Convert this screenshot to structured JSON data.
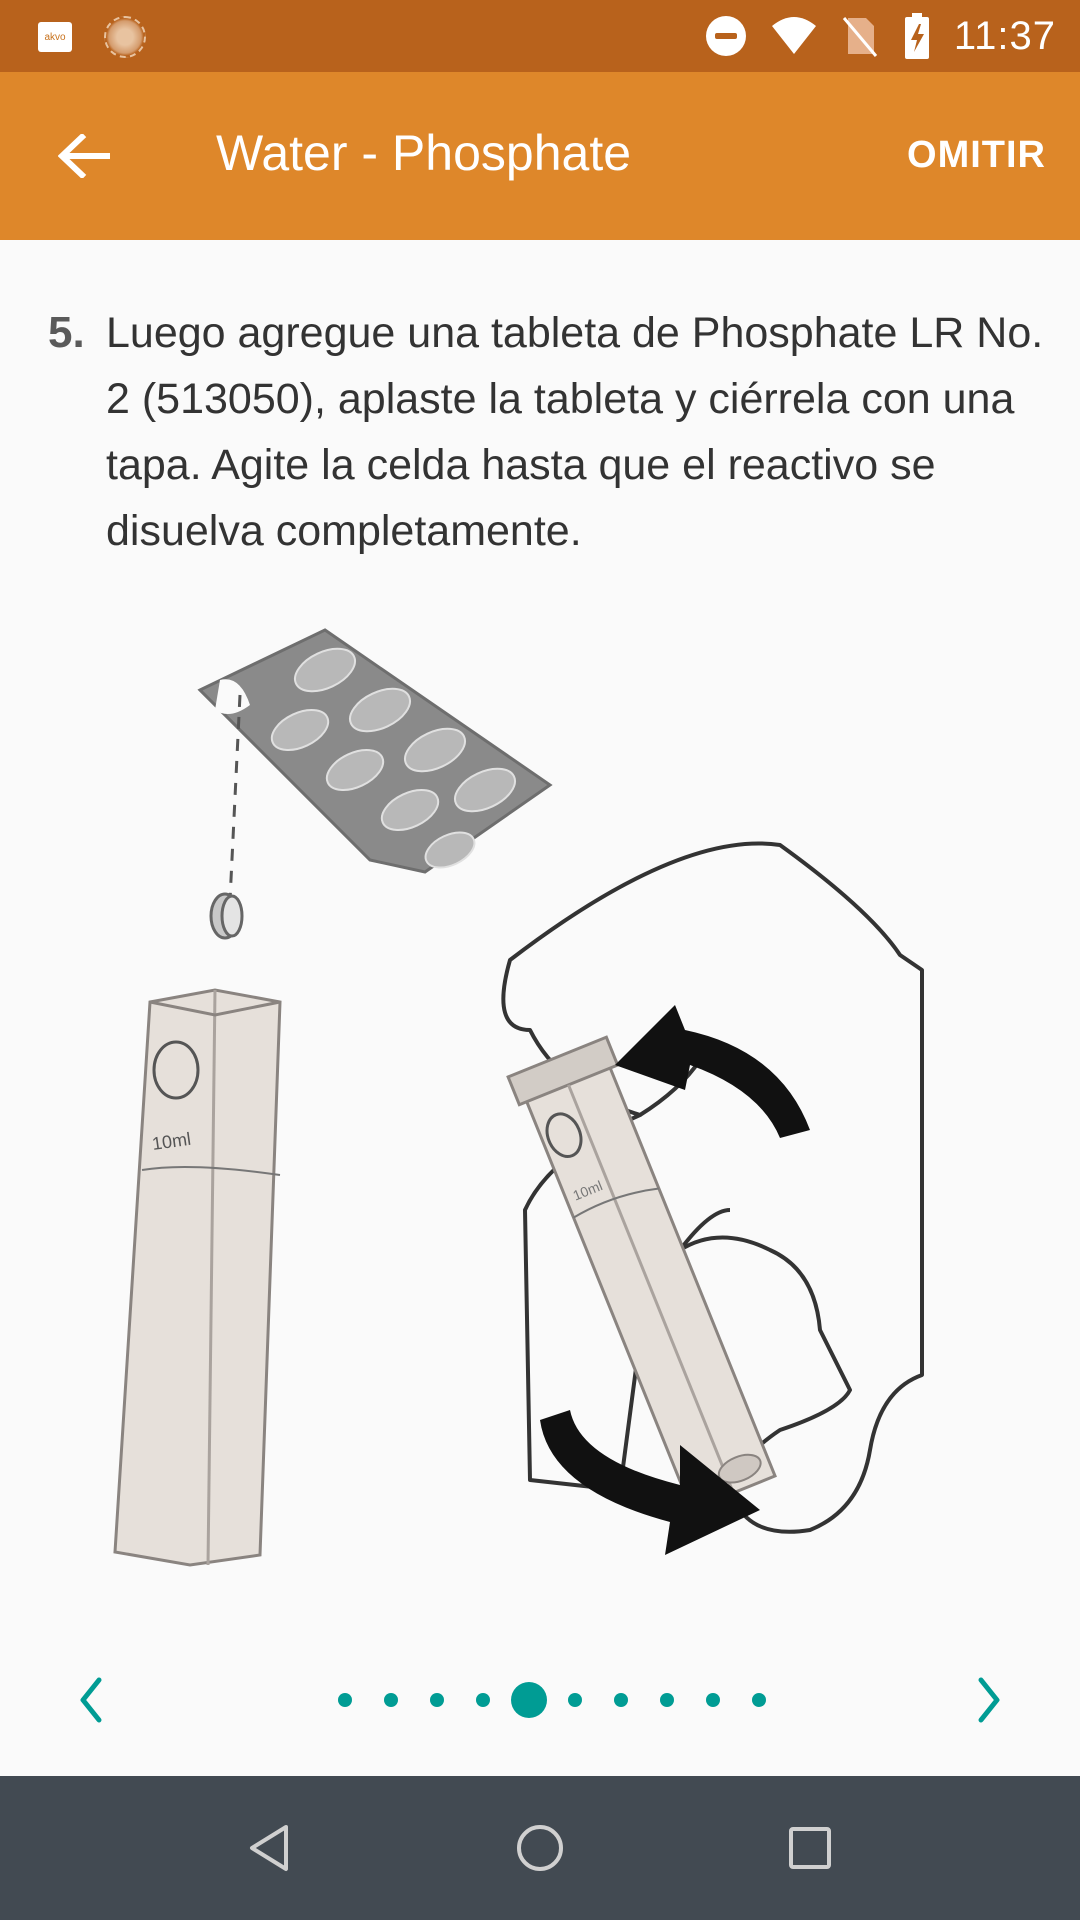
{
  "status_bar": {
    "app_icon_text": "akvo",
    "time": "11:37",
    "icons": [
      "akvo-app-icon",
      "sun-icon",
      "do-not-disturb-icon",
      "wifi-icon",
      "no-sim-icon",
      "battery-charging-icon"
    ]
  },
  "app_bar": {
    "title": "Water - Phosphate",
    "skip_label": "OMITIR",
    "back_icon": "arrow-left-icon"
  },
  "instruction": {
    "step_number": "5.",
    "text": "Luego agregue una tableta de Phosphate LR No. 2 (513050), aplaste la tableta y ciérrela con una tapa. Agite la celda hasta que el reactivo se disuelva completamente."
  },
  "illustration": {
    "cell_label_left": "10ml",
    "cell_label_right": "10ml"
  },
  "pager": {
    "total_pages": 10,
    "current_page": 5,
    "prev_icon": "chevron-left-icon",
    "next_icon": "chevron-right-icon"
  },
  "colors": {
    "status_bar": "#b8621c",
    "app_bar": "#de872a",
    "accent": "#009c94",
    "nav_bar": "#424a52"
  }
}
